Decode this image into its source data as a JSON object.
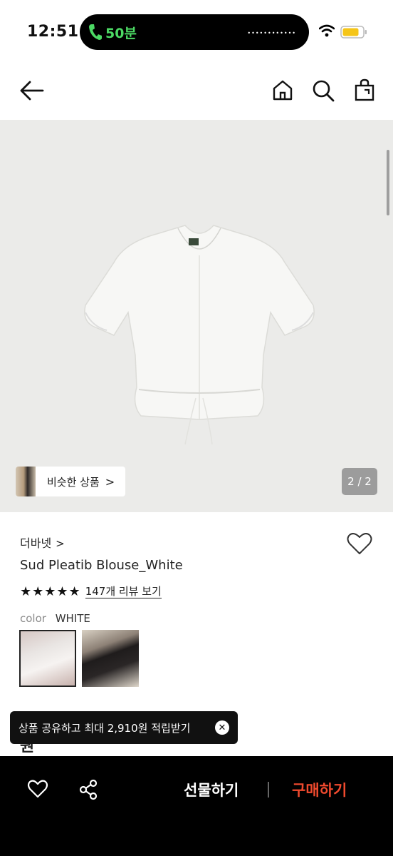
{
  "status_bar": {
    "time": "12:51",
    "call_duration": "50분",
    "call_color": "#4cd964"
  },
  "nav": {
    "back_icon": "arrow-left-icon",
    "home_icon": "home-icon",
    "search_icon": "search-icon",
    "bag_icon": "shopping-bag-icon"
  },
  "image": {
    "similar_label": "비슷한 상품",
    "similar_chevron": ">",
    "page_indicator": "2 / 2",
    "background": "#ebebe9"
  },
  "product": {
    "brand": "더바넷",
    "brand_chevron": ">",
    "title": "Sud Pleatib Blouse_White",
    "stars": "★★★★★",
    "rating_count": 5,
    "review_link": "147개 리뷰 보기",
    "color_label": "color",
    "color_value": "WHITE",
    "swatches": [
      "white-swatch",
      "black-swatch"
    ],
    "price_partial": "원"
  },
  "toast": {
    "text": "상품 공유하고 최대 2,910원 적립받기",
    "close": "✕"
  },
  "bottom": {
    "gift_label": "선물하기",
    "buy_label": "구매하기",
    "buy_color": "#f04a2e",
    "heart_icon": "heart-icon",
    "share_icon": "share-icon"
  }
}
